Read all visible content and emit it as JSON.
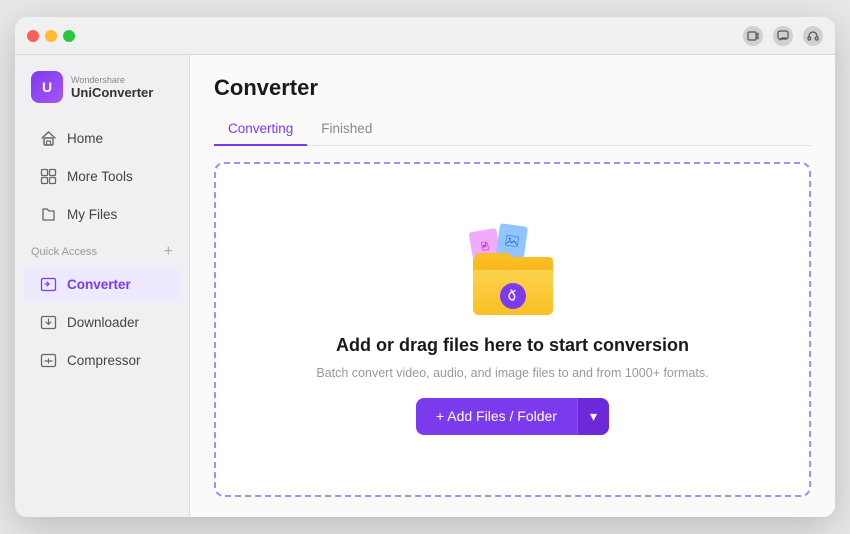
{
  "window": {
    "title": "Wondershare UniConverter"
  },
  "titlebar": {
    "icons": [
      "video-icon",
      "chat-icon",
      "headphone-icon"
    ]
  },
  "sidebar": {
    "logo": {
      "brand": "Wondershare",
      "name": "UniConverter"
    },
    "nav_items": [
      {
        "id": "home",
        "label": "Home",
        "icon": "home-icon",
        "active": false
      },
      {
        "id": "more-tools",
        "label": "More Tools",
        "icon": "tools-icon",
        "active": false
      },
      {
        "id": "my-files",
        "label": "My Files",
        "icon": "files-icon",
        "active": false
      }
    ],
    "quick_access_label": "Quick Access",
    "quick_access_plus": "+",
    "quick_access_items": [
      {
        "id": "converter",
        "label": "Converter",
        "icon": "converter-icon",
        "active": true
      },
      {
        "id": "downloader",
        "label": "Downloader",
        "icon": "downloader-icon",
        "active": false
      },
      {
        "id": "compressor",
        "label": "Compressor",
        "icon": "compressor-icon",
        "active": false
      }
    ]
  },
  "content": {
    "page_title": "Converter",
    "tabs": [
      {
        "id": "converting",
        "label": "Converting",
        "active": true
      },
      {
        "id": "finished",
        "label": "Finished",
        "active": false
      }
    ],
    "drop_zone": {
      "title": "Add or drag files here to start conversion",
      "subtitle": "Batch convert video, audio, and image files to and from 1000+ formats.",
      "add_button_label": "+ Add Files / Folder",
      "arrow_label": "▾"
    }
  }
}
